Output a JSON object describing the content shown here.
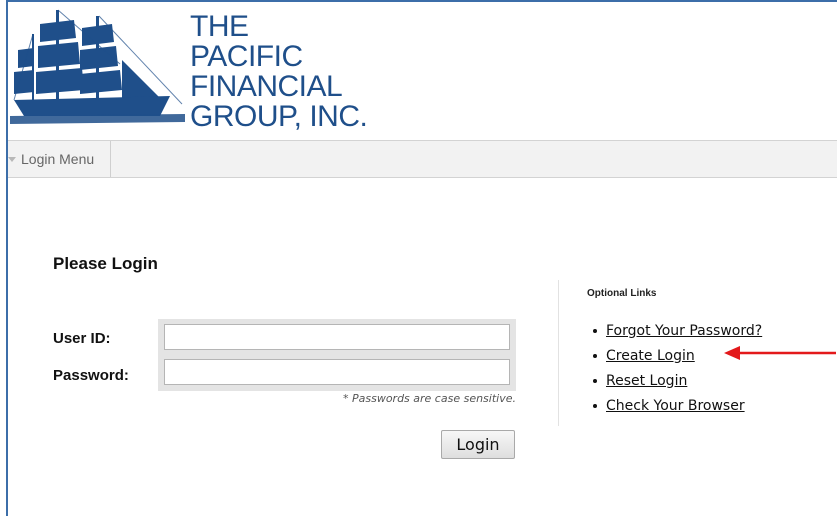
{
  "company": {
    "name_lines": [
      "THE",
      "PACIFIC",
      "FINANCIAL",
      "GROUP, INC."
    ],
    "brand_color": "#1f4f8a"
  },
  "menu": {
    "items": [
      {
        "label": "Login Menu",
        "icon": "caret-down-icon"
      }
    ]
  },
  "login": {
    "title": "Please Login",
    "user_label": "User ID:",
    "user_value": "",
    "password_label": "Password:",
    "password_value": "",
    "note": "* Passwords are case sensitive.",
    "button_label": "Login"
  },
  "optional_links": {
    "title": "Optional Links",
    "items": [
      {
        "label": "Forgot Your Password?"
      },
      {
        "label": "Create Login"
      },
      {
        "label": "Reset Login"
      },
      {
        "label": "Check Your Browser"
      }
    ],
    "annotation_arrow_color": "#e3191b"
  }
}
